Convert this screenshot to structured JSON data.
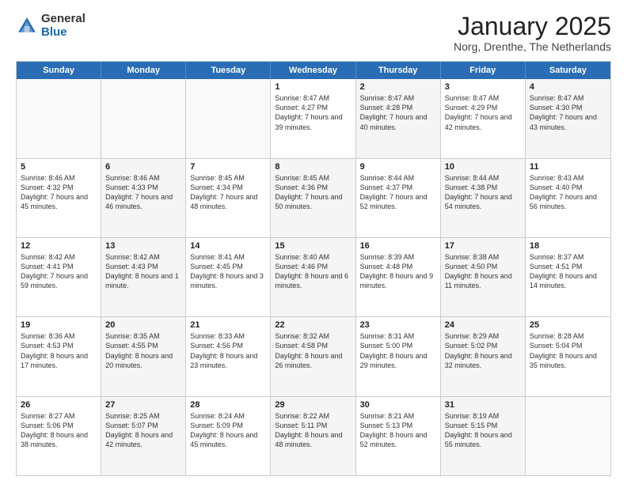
{
  "logo": {
    "general": "General",
    "blue": "Blue"
  },
  "title": "January 2025",
  "subtitle": "Norg, Drenthe, The Netherlands",
  "header_days": [
    "Sunday",
    "Monday",
    "Tuesday",
    "Wednesday",
    "Thursday",
    "Friday",
    "Saturday"
  ],
  "weeks": [
    [
      {
        "day": "",
        "sunrise": "",
        "sunset": "",
        "daylight": "",
        "shaded": false,
        "empty": true
      },
      {
        "day": "",
        "sunrise": "",
        "sunset": "",
        "daylight": "",
        "shaded": false,
        "empty": true
      },
      {
        "day": "",
        "sunrise": "",
        "sunset": "",
        "daylight": "",
        "shaded": false,
        "empty": true
      },
      {
        "day": "1",
        "sunrise": "Sunrise: 8:47 AM",
        "sunset": "Sunset: 4:27 PM",
        "daylight": "Daylight: 7 hours and 39 minutes.",
        "shaded": false,
        "empty": false
      },
      {
        "day": "2",
        "sunrise": "Sunrise: 8:47 AM",
        "sunset": "Sunset: 4:28 PM",
        "daylight": "Daylight: 7 hours and 40 minutes.",
        "shaded": true,
        "empty": false
      },
      {
        "day": "3",
        "sunrise": "Sunrise: 8:47 AM",
        "sunset": "Sunset: 4:29 PM",
        "daylight": "Daylight: 7 hours and 42 minutes.",
        "shaded": false,
        "empty": false
      },
      {
        "day": "4",
        "sunrise": "Sunrise: 8:47 AM",
        "sunset": "Sunset: 4:30 PM",
        "daylight": "Daylight: 7 hours and 43 minutes.",
        "shaded": true,
        "empty": false
      }
    ],
    [
      {
        "day": "5",
        "sunrise": "Sunrise: 8:46 AM",
        "sunset": "Sunset: 4:32 PM",
        "daylight": "Daylight: 7 hours and 45 minutes.",
        "shaded": false,
        "empty": false
      },
      {
        "day": "6",
        "sunrise": "Sunrise: 8:46 AM",
        "sunset": "Sunset: 4:33 PM",
        "daylight": "Daylight: 7 hours and 46 minutes.",
        "shaded": true,
        "empty": false
      },
      {
        "day": "7",
        "sunrise": "Sunrise: 8:45 AM",
        "sunset": "Sunset: 4:34 PM",
        "daylight": "Daylight: 7 hours and 48 minutes.",
        "shaded": false,
        "empty": false
      },
      {
        "day": "8",
        "sunrise": "Sunrise: 8:45 AM",
        "sunset": "Sunset: 4:36 PM",
        "daylight": "Daylight: 7 hours and 50 minutes.",
        "shaded": true,
        "empty": false
      },
      {
        "day": "9",
        "sunrise": "Sunrise: 8:44 AM",
        "sunset": "Sunset: 4:37 PM",
        "daylight": "Daylight: 7 hours and 52 minutes.",
        "shaded": false,
        "empty": false
      },
      {
        "day": "10",
        "sunrise": "Sunrise: 8:44 AM",
        "sunset": "Sunset: 4:38 PM",
        "daylight": "Daylight: 7 hours and 54 minutes.",
        "shaded": true,
        "empty": false
      },
      {
        "day": "11",
        "sunrise": "Sunrise: 8:43 AM",
        "sunset": "Sunset: 4:40 PM",
        "daylight": "Daylight: 7 hours and 56 minutes.",
        "shaded": false,
        "empty": false
      }
    ],
    [
      {
        "day": "12",
        "sunrise": "Sunrise: 8:42 AM",
        "sunset": "Sunset: 4:41 PM",
        "daylight": "Daylight: 7 hours and 59 minutes.",
        "shaded": false,
        "empty": false
      },
      {
        "day": "13",
        "sunrise": "Sunrise: 8:42 AM",
        "sunset": "Sunset: 4:43 PM",
        "daylight": "Daylight: 8 hours and 1 minute.",
        "shaded": true,
        "empty": false
      },
      {
        "day": "14",
        "sunrise": "Sunrise: 8:41 AM",
        "sunset": "Sunset: 4:45 PM",
        "daylight": "Daylight: 8 hours and 3 minutes.",
        "shaded": false,
        "empty": false
      },
      {
        "day": "15",
        "sunrise": "Sunrise: 8:40 AM",
        "sunset": "Sunset: 4:46 PM",
        "daylight": "Daylight: 8 hours and 6 minutes.",
        "shaded": true,
        "empty": false
      },
      {
        "day": "16",
        "sunrise": "Sunrise: 8:39 AM",
        "sunset": "Sunset: 4:48 PM",
        "daylight": "Daylight: 8 hours and 9 minutes.",
        "shaded": false,
        "empty": false
      },
      {
        "day": "17",
        "sunrise": "Sunrise: 8:38 AM",
        "sunset": "Sunset: 4:50 PM",
        "daylight": "Daylight: 8 hours and 11 minutes.",
        "shaded": true,
        "empty": false
      },
      {
        "day": "18",
        "sunrise": "Sunrise: 8:37 AM",
        "sunset": "Sunset: 4:51 PM",
        "daylight": "Daylight: 8 hours and 14 minutes.",
        "shaded": false,
        "empty": false
      }
    ],
    [
      {
        "day": "19",
        "sunrise": "Sunrise: 8:36 AM",
        "sunset": "Sunset: 4:53 PM",
        "daylight": "Daylight: 8 hours and 17 minutes.",
        "shaded": false,
        "empty": false
      },
      {
        "day": "20",
        "sunrise": "Sunrise: 8:35 AM",
        "sunset": "Sunset: 4:55 PM",
        "daylight": "Daylight: 8 hours and 20 minutes.",
        "shaded": true,
        "empty": false
      },
      {
        "day": "21",
        "sunrise": "Sunrise: 8:33 AM",
        "sunset": "Sunset: 4:56 PM",
        "daylight": "Daylight: 8 hours and 23 minutes.",
        "shaded": false,
        "empty": false
      },
      {
        "day": "22",
        "sunrise": "Sunrise: 8:32 AM",
        "sunset": "Sunset: 4:58 PM",
        "daylight": "Daylight: 8 hours and 26 minutes.",
        "shaded": true,
        "empty": false
      },
      {
        "day": "23",
        "sunrise": "Sunrise: 8:31 AM",
        "sunset": "Sunset: 5:00 PM",
        "daylight": "Daylight: 8 hours and 29 minutes.",
        "shaded": false,
        "empty": false
      },
      {
        "day": "24",
        "sunrise": "Sunrise: 8:29 AM",
        "sunset": "Sunset: 5:02 PM",
        "daylight": "Daylight: 8 hours and 32 minutes.",
        "shaded": true,
        "empty": false
      },
      {
        "day": "25",
        "sunrise": "Sunrise: 8:28 AM",
        "sunset": "Sunset: 5:04 PM",
        "daylight": "Daylight: 8 hours and 35 minutes.",
        "shaded": false,
        "empty": false
      }
    ],
    [
      {
        "day": "26",
        "sunrise": "Sunrise: 8:27 AM",
        "sunset": "Sunset: 5:06 PM",
        "daylight": "Daylight: 8 hours and 38 minutes.",
        "shaded": false,
        "empty": false
      },
      {
        "day": "27",
        "sunrise": "Sunrise: 8:25 AM",
        "sunset": "Sunset: 5:07 PM",
        "daylight": "Daylight: 8 hours and 42 minutes.",
        "shaded": true,
        "empty": false
      },
      {
        "day": "28",
        "sunrise": "Sunrise: 8:24 AM",
        "sunset": "Sunset: 5:09 PM",
        "daylight": "Daylight: 8 hours and 45 minutes.",
        "shaded": false,
        "empty": false
      },
      {
        "day": "29",
        "sunrise": "Sunrise: 8:22 AM",
        "sunset": "Sunset: 5:11 PM",
        "daylight": "Daylight: 8 hours and 48 minutes.",
        "shaded": true,
        "empty": false
      },
      {
        "day": "30",
        "sunrise": "Sunrise: 8:21 AM",
        "sunset": "Sunset: 5:13 PM",
        "daylight": "Daylight: 8 hours and 52 minutes.",
        "shaded": false,
        "empty": false
      },
      {
        "day": "31",
        "sunrise": "Sunrise: 8:19 AM",
        "sunset": "Sunset: 5:15 PM",
        "daylight": "Daylight: 8 hours and 55 minutes.",
        "shaded": true,
        "empty": false
      },
      {
        "day": "",
        "sunrise": "",
        "sunset": "",
        "daylight": "",
        "shaded": false,
        "empty": true
      }
    ]
  ]
}
